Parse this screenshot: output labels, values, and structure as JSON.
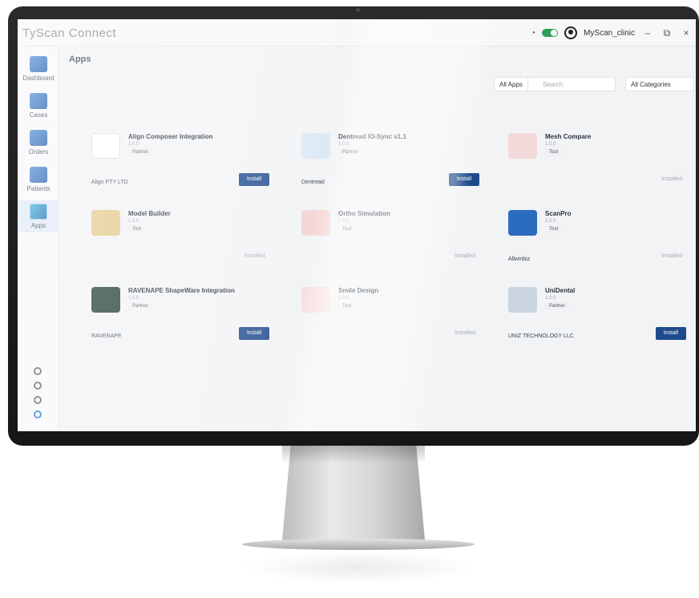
{
  "app": {
    "title": "TyScan Connect",
    "user": "MyScan_clinic"
  },
  "window": {
    "minimize": "–",
    "maximize": "⧉",
    "close": "×"
  },
  "sidebar": {
    "items": [
      {
        "label": "Dashboard",
        "icon": "dashboard-icon"
      },
      {
        "label": "Cases",
        "icon": "cases-icon"
      },
      {
        "label": "Orders",
        "icon": "orders-icon"
      },
      {
        "label": "Patients",
        "icon": "patients-icon"
      },
      {
        "label": "Apps",
        "icon": "apps-icon"
      }
    ]
  },
  "page": {
    "title": "Apps"
  },
  "filters": {
    "apps": "All Apps",
    "search_placeholder": "Search",
    "category": "All Categories"
  },
  "cards": [
    {
      "name": "Align Composer Integration",
      "version": "1.0.0",
      "tag": "Partner",
      "vendor": "Align PTY LTD",
      "action": "Install",
      "action_type": "button"
    },
    {
      "name": "Dentread IO-Sync v1.1",
      "version": "1.0.0",
      "tag": "Partner",
      "vendor": "Dentread",
      "action": "Install",
      "action_type": "button"
    },
    {
      "name": "Mesh Compare",
      "version": "1.0.0",
      "tag": "Tool",
      "vendor": "",
      "action": "Installed",
      "action_type": "status"
    },
    {
      "name": "Model Builder",
      "version": "1.0.0",
      "tag": "Tool",
      "vendor": "",
      "action": "Installed",
      "action_type": "status"
    },
    {
      "name": "Ortho Simulation",
      "version": "1.0.0",
      "tag": "Tool",
      "vendor": "",
      "action": "Installed",
      "action_type": "status"
    },
    {
      "name": "ScanPro",
      "version": "1.0.0",
      "tag": "Tool",
      "vendor": "Allwinbiz",
      "action": "Installed",
      "action_type": "status"
    },
    {
      "name": "RAVENAPE ShapeWare Integration",
      "version": "1.0.0",
      "tag": "Partner",
      "vendor": "RAVENAPE",
      "action": "Install",
      "action_type": "button"
    },
    {
      "name": "Smile Design",
      "version": "1.0.0",
      "tag": "Tool",
      "vendor": "",
      "action": "Installed",
      "action_type": "status"
    },
    {
      "name": "UniDental",
      "version": "1.0.0",
      "tag": "Partner",
      "vendor": "UNIZ TECHNOLOGY LLC",
      "action": "Install",
      "action_type": "button"
    }
  ],
  "colors": {
    "accent": "#1e4a8c",
    "toggle_on": "#2e9e57",
    "bezel": "#1c1c1e"
  }
}
